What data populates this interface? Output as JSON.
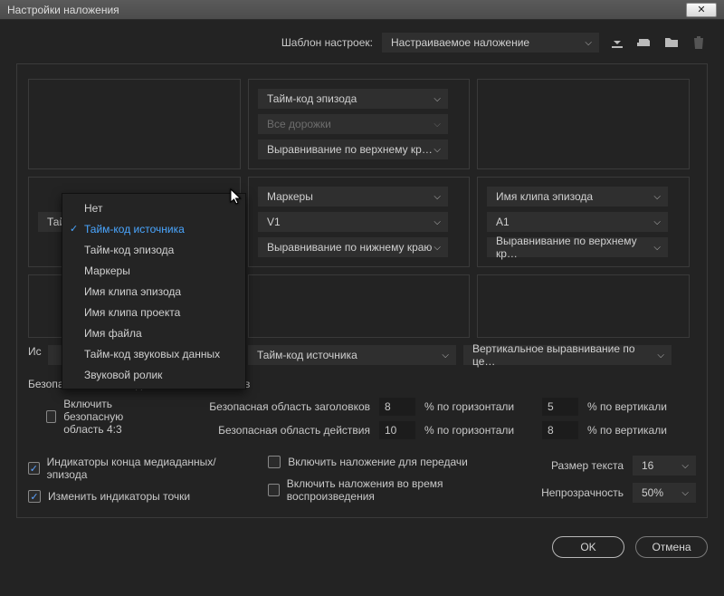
{
  "window": {
    "title": "Настройки наложения"
  },
  "preset": {
    "label": "Шаблон настроек:",
    "value": "Настраиваемое наложение"
  },
  "topleft": {
    "value": "Тайм-код источника"
  },
  "center_top": {
    "r1": "Тайм-код эпизода",
    "r2": "Все дорожки",
    "r3": "Выравнивание по верхнему кр…"
  },
  "center_bottom": {
    "r1": "Маркеры",
    "r2": "V1",
    "r3": "Выравнивание по нижнему краю"
  },
  "right": {
    "r1": "Имя клипа эпизода",
    "r2": "A1",
    "r3": "Выравнивание по верхнему кр…"
  },
  "mid_left_label": "Ис",
  "mid_center": "Тайм-код источника",
  "mid_right": "Вертикальное выравнивание по це…",
  "dropdown": {
    "items": [
      "Нет",
      "Тайм-код источника",
      "Тайм-код эпизода",
      "Маркеры",
      "Имя клипа эпизода",
      "Имя клипа проекта",
      "Имя файла",
      "Тайм-код звуковых данных",
      "Звуковой ролик"
    ],
    "selected": "Тайм-код источника"
  },
  "safe": {
    "header": "Безопасные области действий и заголовков",
    "enable_43": "Включить безопасную область 4:3",
    "title_label": "Безопасная область заголовков",
    "action_label": "Безопасная область действия",
    "title_h": "8",
    "title_v": "5",
    "action_h": "10",
    "action_v": "8",
    "pct_h": "% по горизонтали",
    "pct_v": "% по вертикали"
  },
  "checks": {
    "media_end": "Индикаторы конца медиаданных/эпизода",
    "edit_points": "Изменить индикаторы точки",
    "overlay_transfer": "Включить наложение для передачи",
    "overlay_playback": "Включить наложения во время воспроизведения"
  },
  "right_opts": {
    "text_size_label": "Размер текста",
    "text_size": "16",
    "opacity_label": "Непрозрачность",
    "opacity": "50%"
  },
  "buttons": {
    "ok": "OK",
    "cancel": "Отмена"
  }
}
